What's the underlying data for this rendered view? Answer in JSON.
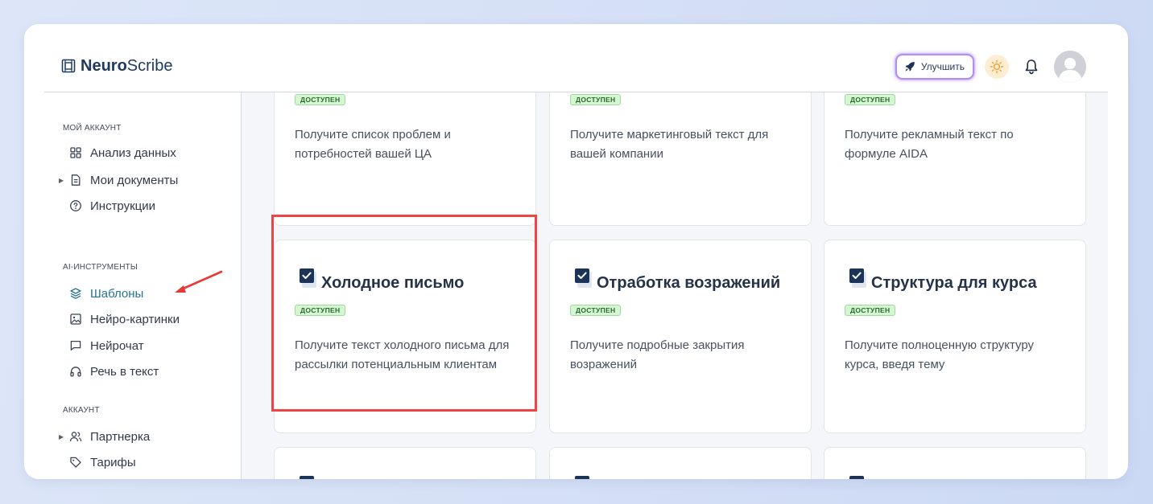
{
  "app": {
    "logo_bold": "Neuro",
    "logo_rest": "Scribe"
  },
  "header": {
    "upgrade_label": "Улучшить"
  },
  "sidebar": {
    "sections": [
      {
        "title": "Мой аккаунт",
        "items": [
          {
            "label": "Анализ данных",
            "icon": "grid-icon"
          },
          {
            "label": "Мои документы",
            "icon": "document-icon",
            "expandable": true
          },
          {
            "label": "Инструкции",
            "icon": "help-circle-icon"
          }
        ]
      },
      {
        "title": "AI-инструменты",
        "items": [
          {
            "label": "Шаблоны",
            "icon": "layers-icon",
            "active": true
          },
          {
            "label": "Нейро-картинки",
            "icon": "image-icon"
          },
          {
            "label": "Нейрочат",
            "icon": "chat-icon"
          },
          {
            "label": "Речь в текст",
            "icon": "headphones-icon"
          }
        ]
      },
      {
        "title": "Аккаунт",
        "items": [
          {
            "label": "Партнерка",
            "icon": "users-icon",
            "expandable": true
          },
          {
            "label": "Тарифы",
            "icon": "tag-icon"
          }
        ]
      }
    ]
  },
  "badge_label": "Доступен",
  "cards": [
    {
      "title": "",
      "desc": "Получите список проблем и потребностей вашей ЦА"
    },
    {
      "title": "",
      "desc": "Получите маркетинговый текст для вашей компании"
    },
    {
      "title": "",
      "desc": "Получите рекламный текст по формуле AIDA"
    },
    {
      "title": "Холодное письмо",
      "desc": "Получите текст холодного письма для рассылки потенциальным клиентам"
    },
    {
      "title": "Отработка возражений",
      "desc": "Получите подробные закрытия возражений"
    },
    {
      "title": "Структура для курса",
      "desc": "Получите полноценную структуру курса, введя тему"
    }
  ],
  "colors": {
    "accent": "#27728f",
    "highlight": "#ef4444",
    "badge_bg": "#d5f6d2",
    "badge_text": "#2b6a2f"
  }
}
